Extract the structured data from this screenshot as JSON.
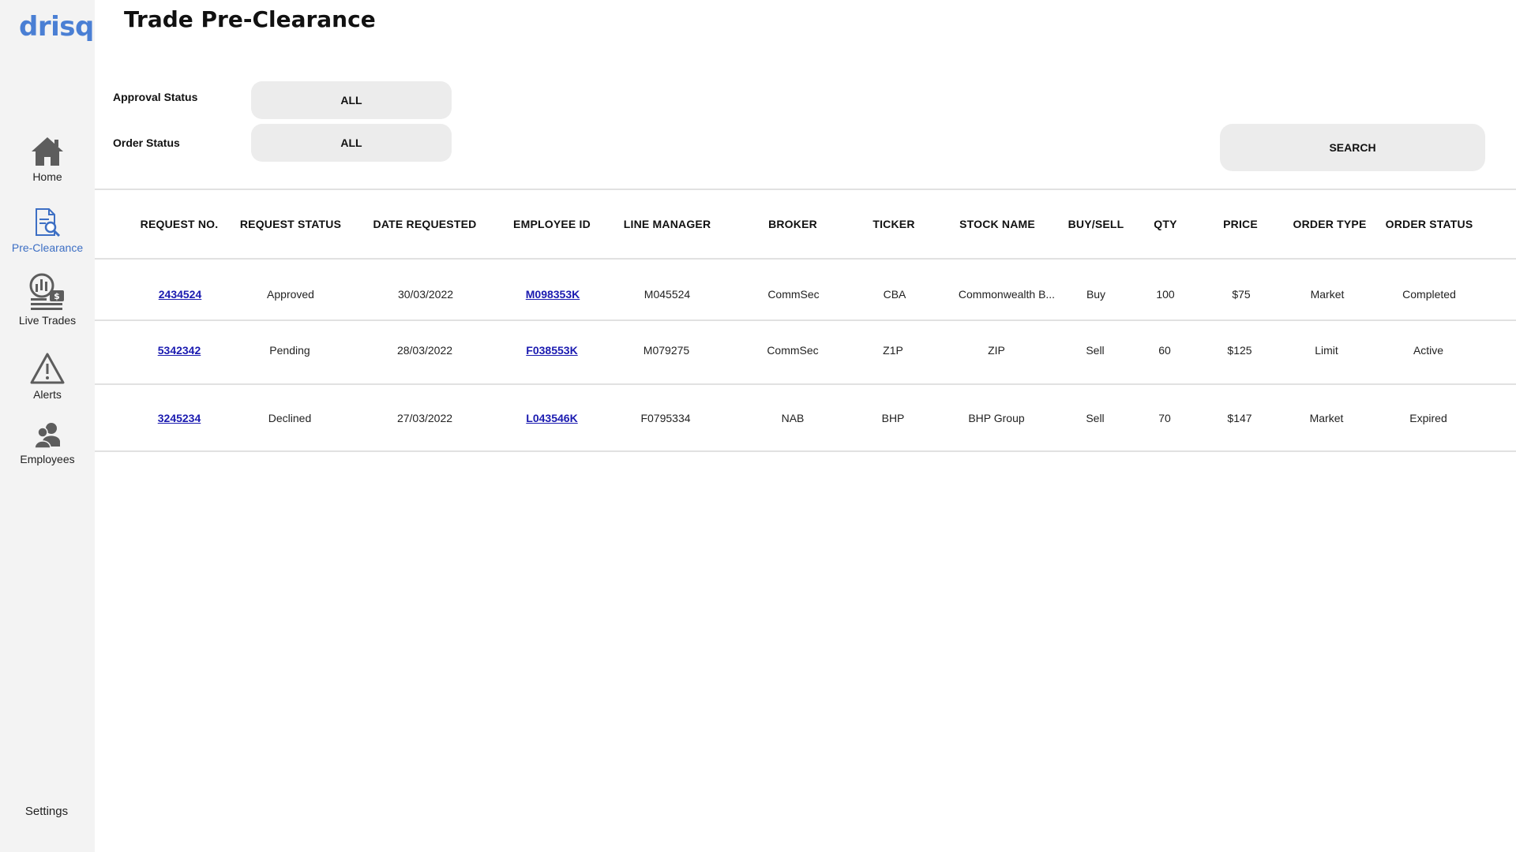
{
  "app": {
    "logo": "drisq",
    "title": "Trade Pre-Clearance"
  },
  "sidebar": {
    "items": [
      {
        "label": "Home",
        "icon": "home-icon"
      },
      {
        "label": "Pre-Clearance",
        "icon": "document-search-icon",
        "active": true
      },
      {
        "label": "Live Trades",
        "icon": "live-trades-icon"
      },
      {
        "label": "Alerts",
        "icon": "warning-icon"
      },
      {
        "label": "Employees",
        "icon": "users-icon"
      }
    ],
    "settings_label": "Settings",
    "accent_color": "#3d6fc4"
  },
  "filters": {
    "approval_status": {
      "label": "Approval Status",
      "value": "ALL"
    },
    "order_status": {
      "label": "Order Status",
      "value": "ALL"
    },
    "search_label": "SEARCH"
  },
  "table": {
    "headers": [
      "REQUEST NO.",
      "REQUEST STATUS",
      "DATE REQUESTED",
      "EMPLOYEE ID",
      "LINE MANAGER",
      "BROKER",
      "TICKER",
      "STOCK NAME",
      "BUY/SELL",
      "QTY",
      "PRICE",
      "ORDER TYPE",
      "ORDER STATUS"
    ],
    "rows": [
      [
        "2434524",
        "Approved",
        "30/03/2022",
        "M098353K",
        "M045524",
        "CommSec",
        "CBA",
        "Commonwealth B...",
        "Buy",
        "100",
        "$75",
        "Market",
        "Completed"
      ],
      [
        "5342342",
        "Pending",
        "28/03/2022",
        "F038553K",
        "M079275",
        "CommSec",
        "Z1P",
        "ZIP",
        "Sell",
        "60",
        "$125",
        "Limit",
        "Active"
      ],
      [
        "3245234",
        "Declined",
        "27/03/2022",
        "L043546K",
        "F0795334",
        "NAB",
        "BHP",
        "BHP Group",
        "Sell",
        "70",
        "$147",
        "Market",
        "Expired"
      ]
    ]
  }
}
